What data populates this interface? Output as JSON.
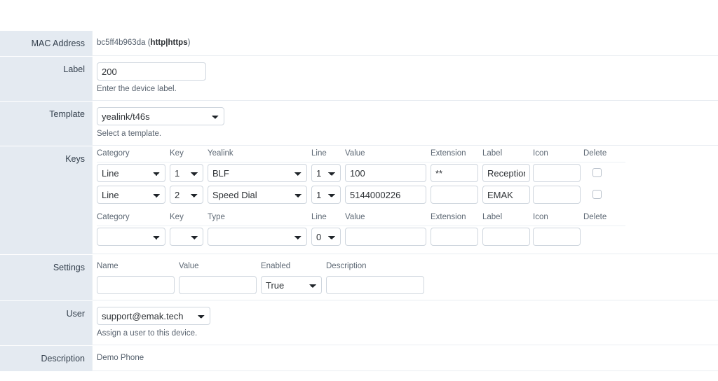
{
  "form": {
    "rows": {
      "mac": {
        "label": "MAC Address",
        "value": "bc5ff4b963da",
        "open_paren": "(",
        "link_http": "http",
        "separator": "|",
        "link_https": "https",
        "close_paren": ")"
      },
      "label": {
        "label": "Label",
        "value": "200",
        "help": "Enter the device label."
      },
      "template": {
        "label": "Template",
        "value": "yealink/t46s",
        "help": "Select a template."
      },
      "keys": {
        "label": "Keys"
      },
      "settings": {
        "label": "Settings"
      },
      "user": {
        "label": "User",
        "value": "support@emak.tech",
        "help": "Assign a user to this device."
      },
      "description": {
        "label": "Description",
        "value": "Demo Phone"
      }
    }
  },
  "keys_table": {
    "headers_top": [
      "Category",
      "Key",
      "Yealink",
      "Line",
      "Value",
      "Extension",
      "Label",
      "Icon",
      "Delete"
    ],
    "headers_bottom": [
      "Category",
      "Key",
      "Type",
      "Line",
      "Value",
      "Extension",
      "Label",
      "Icon",
      "Delete"
    ],
    "rows": [
      {
        "category": "Line",
        "key": "1",
        "type": "BLF",
        "line": "1",
        "value": "100",
        "extension": "**",
        "label": "Reception",
        "icon": "",
        "delete_checked": false
      },
      {
        "category": "Line",
        "key": "2",
        "type": "Speed Dial",
        "line": "1",
        "value": "5144000226",
        "extension": "",
        "label": "EMAK",
        "icon": "",
        "delete_checked": false
      }
    ],
    "new_row": {
      "category": "",
      "key": "",
      "type": "",
      "line": "0",
      "value": "",
      "extension": "",
      "label": "",
      "icon": ""
    }
  },
  "settings_table": {
    "headers": [
      "Name",
      "Value",
      "Enabled",
      "Description"
    ],
    "new_row": {
      "name": "",
      "value": "",
      "enabled": "True",
      "description": ""
    }
  },
  "colors": {
    "label_column_bg": "#e4eaf1",
    "field_border": "#cfd6de",
    "text": "#34404d",
    "muted_text": "#5d6874"
  }
}
